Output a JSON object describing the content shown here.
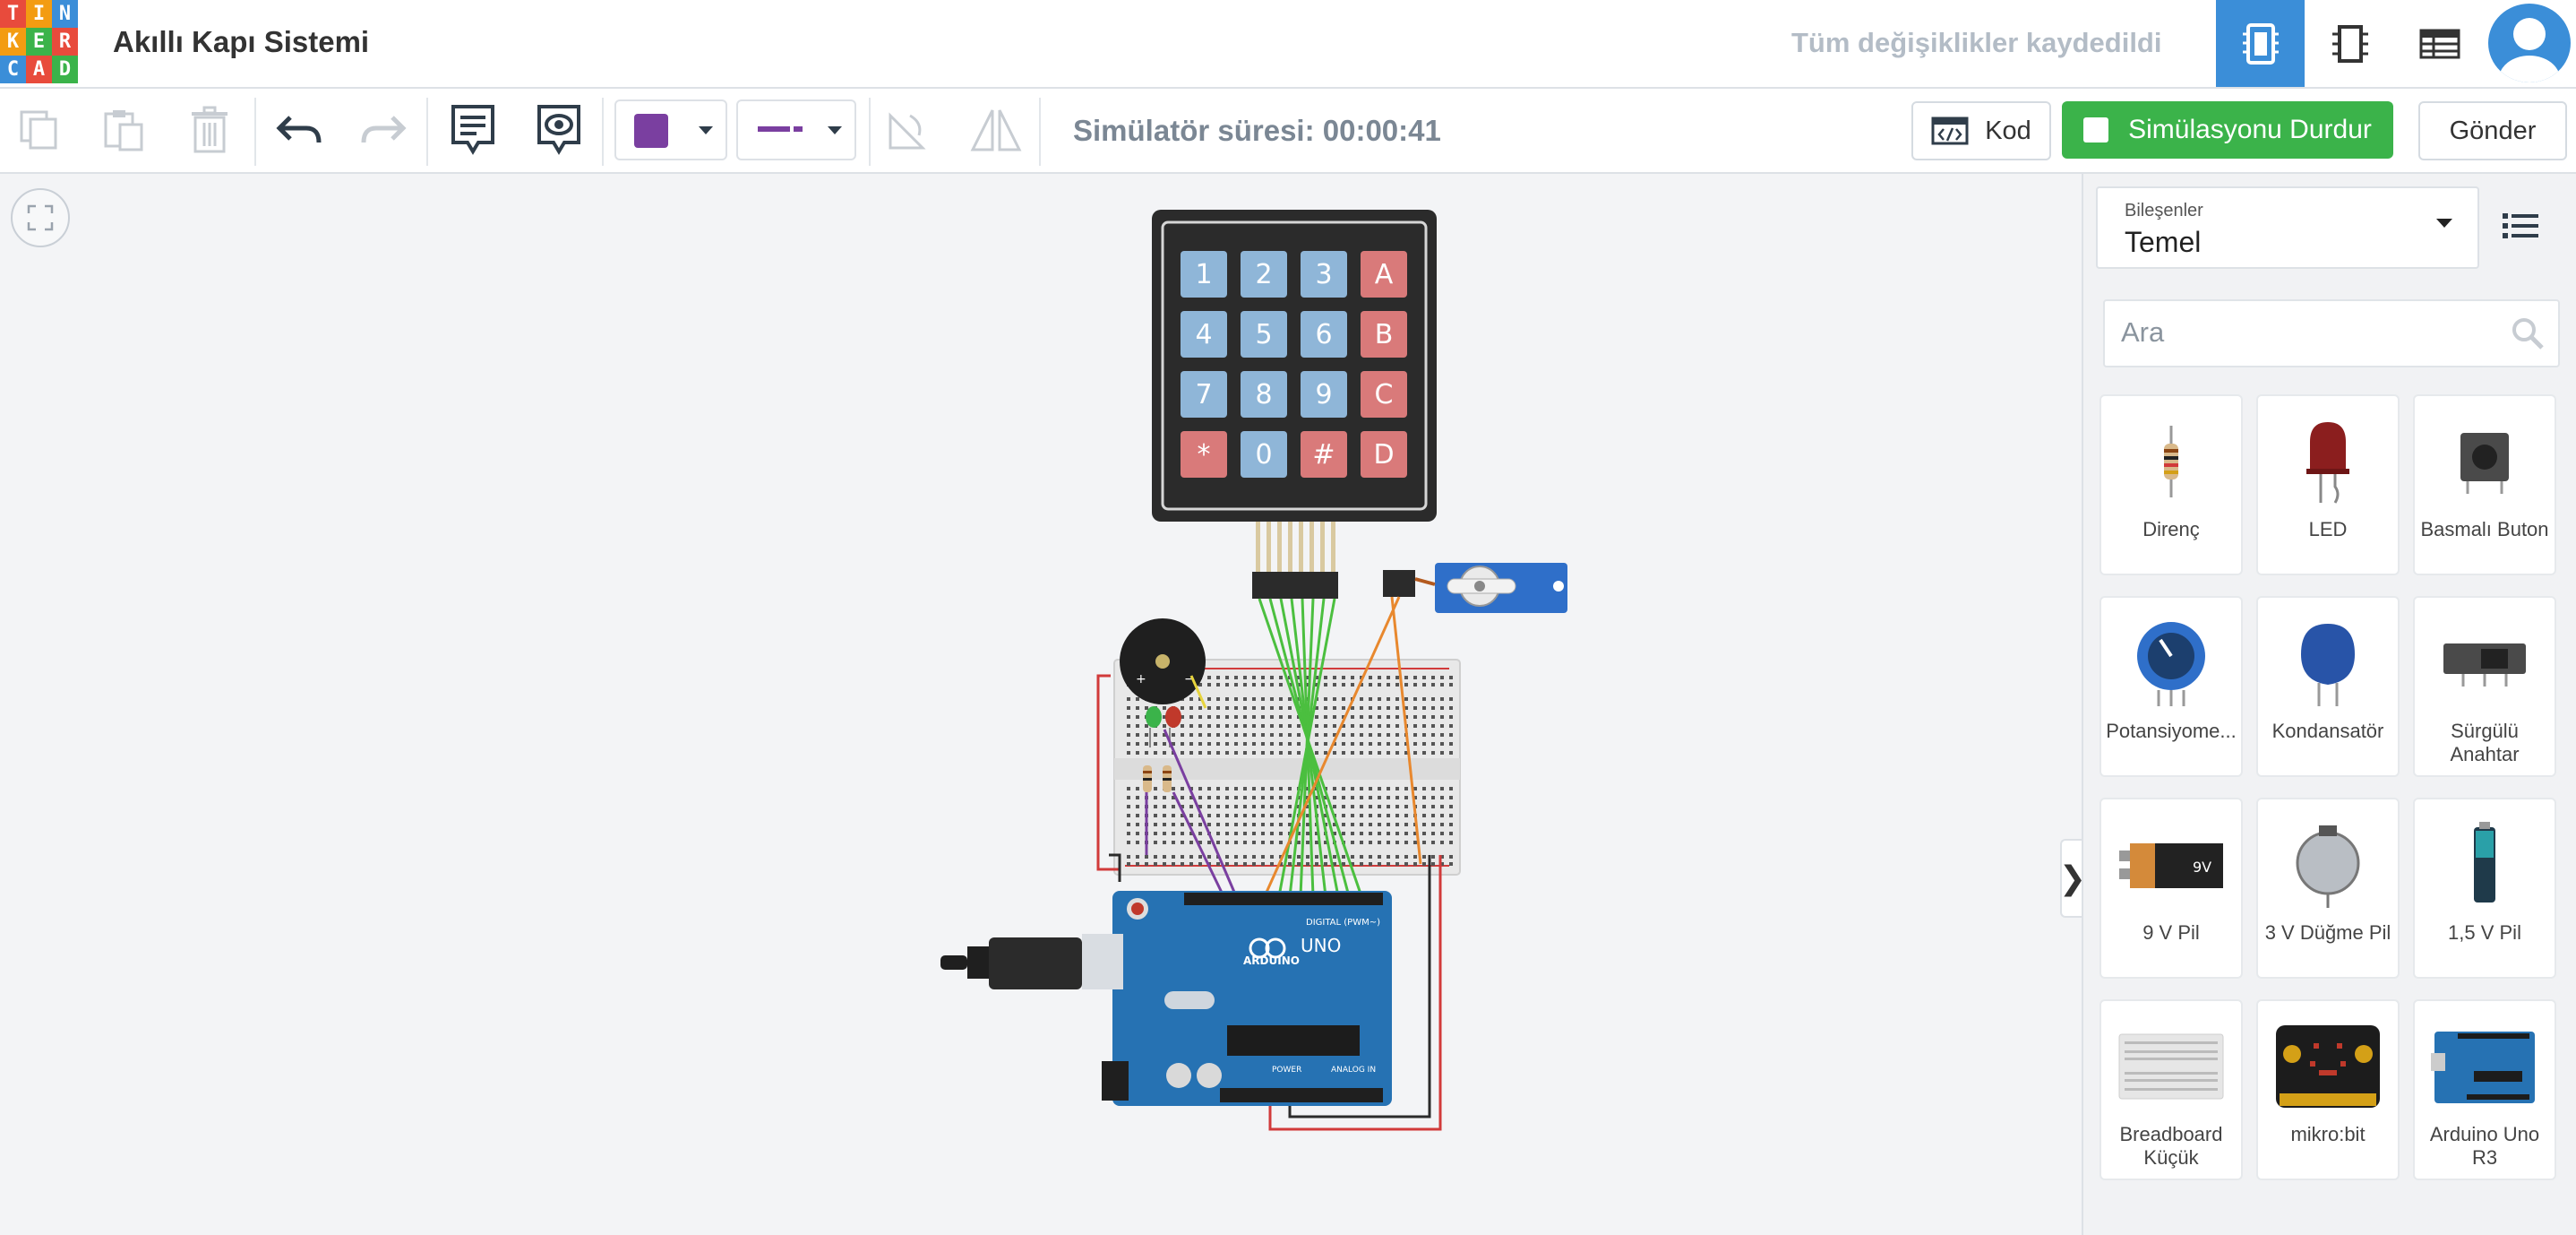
{
  "app": {
    "logo_letters": [
      "T",
      "I",
      "N",
      "K",
      "E",
      "R",
      "C",
      "A",
      "D"
    ],
    "logo_colors": [
      "#e84b3c",
      "#f39c12",
      "#3b8ed8",
      "#f39c12",
      "#3bb34a",
      "#e84b3c",
      "#3b8ed8",
      "#e84b3c",
      "#3bb34a"
    ]
  },
  "header": {
    "title": "Akıllı Kapı Sistemi",
    "save_status": "Tüm değişiklikler kaydedildi",
    "accent": "#3b8ed8"
  },
  "toolbar": {
    "sim_time": "Simülatör süresi: 00:00:41",
    "code_label": "Kod",
    "stop_label": "Simülasyonu Durdur",
    "send_label": "Gönder",
    "color_value": "#7a3fa0"
  },
  "keypad": {
    "keys": [
      "1",
      "2",
      "3",
      "A",
      "4",
      "5",
      "6",
      "B",
      "7",
      "8",
      "9",
      "C",
      "*",
      "0",
      "#",
      "D"
    ]
  },
  "arduino": {
    "brand": "ARDUINO",
    "model": "UNO",
    "digital_label": "DIGITAL (PWM~)",
    "power_label": "POWER",
    "analog_label": "ANALOG IN"
  },
  "sidebar": {
    "components_label": "Bileşenler",
    "components_value": "Temel",
    "search_placeholder": "Ara",
    "items": [
      {
        "name": "Direnç",
        "icon": "resistor-icon"
      },
      {
        "name": "LED",
        "icon": "led-icon"
      },
      {
        "name": "Basmalı Buton",
        "icon": "pushbutton-icon"
      },
      {
        "name": "Potansiyome...",
        "icon": "potentiometer-icon"
      },
      {
        "name": "Kondansatör",
        "icon": "capacitor-icon"
      },
      {
        "name": "Sürgülü Anahtar",
        "icon": "slide-switch-icon"
      },
      {
        "name": "9 V Pil",
        "icon": "battery-9v-icon"
      },
      {
        "name": "3 V Düğme Pil",
        "icon": "coin-cell-icon"
      },
      {
        "name": "1,5 V Pil",
        "icon": "battery-aa-icon"
      },
      {
        "name": "Breadboard Küçük",
        "icon": "breadboard-icon"
      },
      {
        "name": "mikro:bit",
        "icon": "microbit-icon"
      },
      {
        "name": "Arduino Uno R3",
        "icon": "arduino-icon"
      }
    ]
  }
}
